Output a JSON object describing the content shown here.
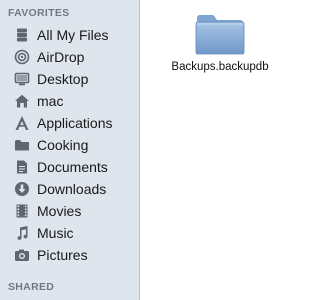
{
  "sidebar": {
    "favorites_header": "FAVORITES",
    "shared_header": "SHARED",
    "items": [
      {
        "label": "All My Files",
        "icon": "all-files-icon"
      },
      {
        "label": "AirDrop",
        "icon": "airdrop-icon"
      },
      {
        "label": "Desktop",
        "icon": "desktop-icon"
      },
      {
        "label": "mac",
        "icon": "home-icon"
      },
      {
        "label": "Applications",
        "icon": "applications-icon"
      },
      {
        "label": "Cooking",
        "icon": "folder-icon"
      },
      {
        "label": "Documents",
        "icon": "documents-icon"
      },
      {
        "label": "Downloads",
        "icon": "downloads-icon"
      },
      {
        "label": "Movies",
        "icon": "movies-icon"
      },
      {
        "label": "Music",
        "icon": "music-icon"
      },
      {
        "label": "Pictures",
        "icon": "pictures-icon"
      }
    ]
  },
  "content": {
    "files": [
      {
        "name": "Backups.backupdb",
        "icon": "folder-icon",
        "color": "#7fa6d2"
      }
    ]
  },
  "colors": {
    "sidebar_bg": "#dfe5ed",
    "section_header": "#6f7884",
    "icon_gray": "#5f6670"
  }
}
